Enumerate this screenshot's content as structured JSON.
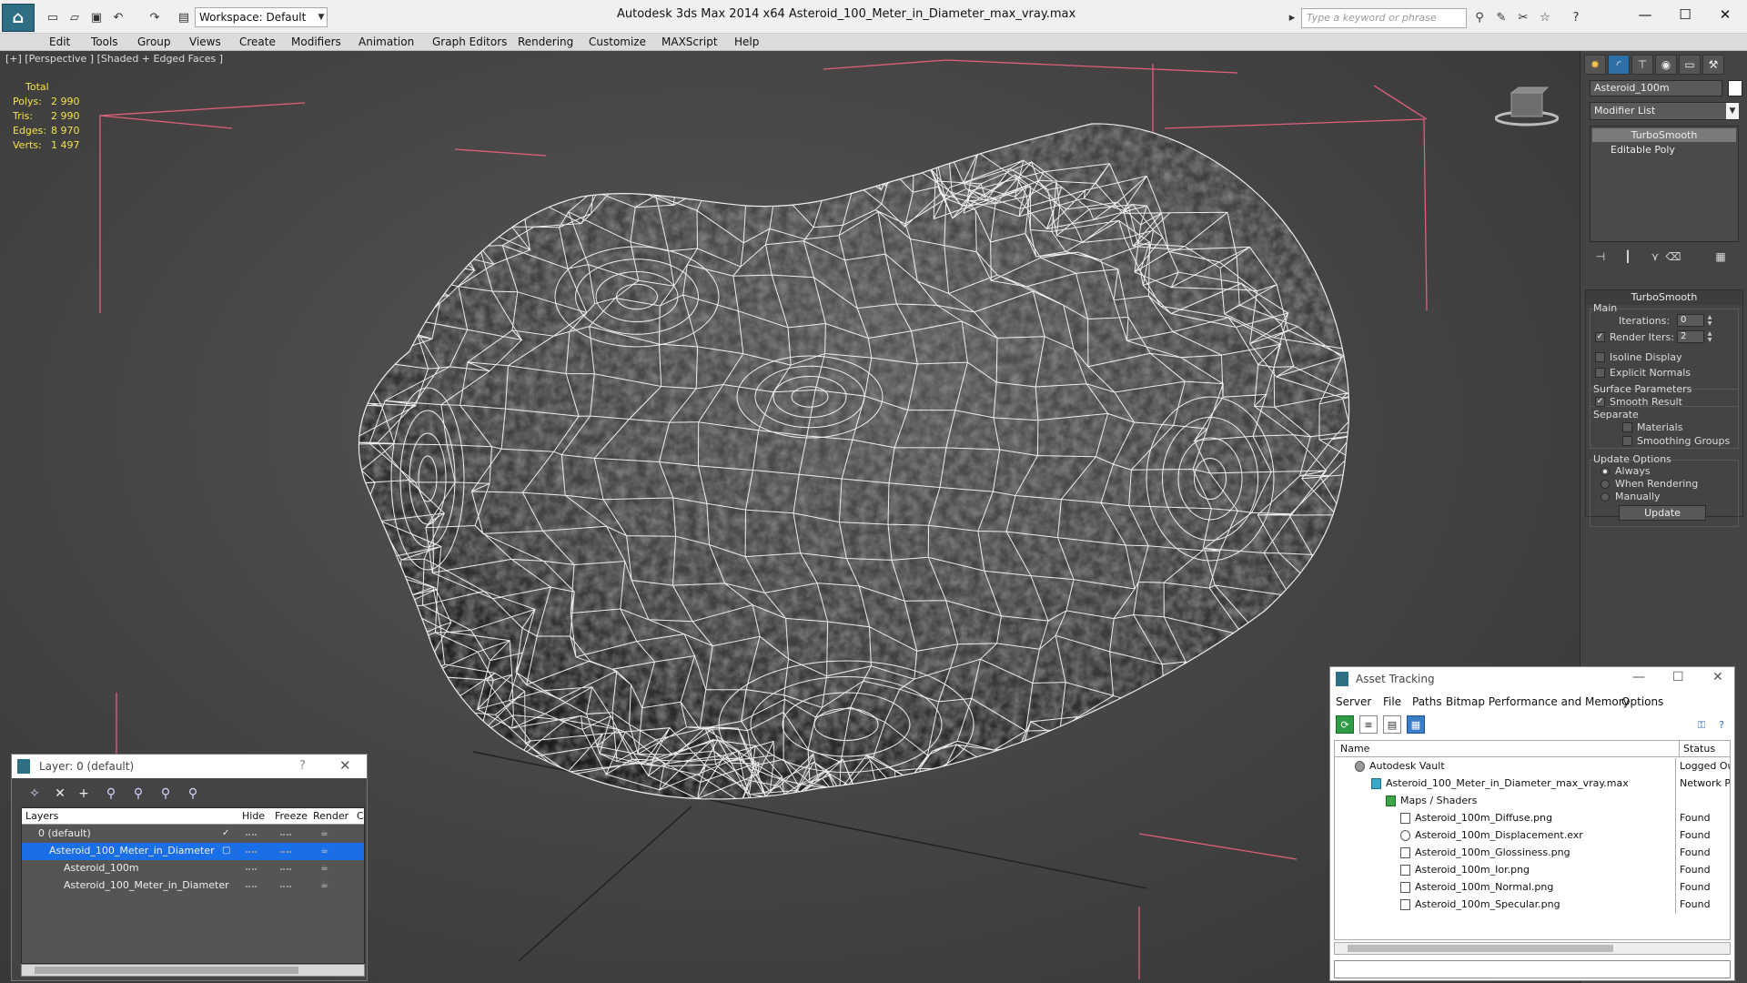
{
  "titlebar": {
    "window_title": "Autodesk 3ds Max  2014 x64      Asteroid_100_Meter_in_Diameter_max_vray.max",
    "workspace": "Workspace: Default",
    "search_placeholder": "Type a keyword or phrase",
    "minimize": "—",
    "maximize": "☐",
    "close": "✕"
  },
  "menu": [
    "Edit",
    "Tools",
    "Group",
    "Views",
    "Create",
    "Modifiers",
    "Animation",
    "Graph Editors",
    "Rendering",
    "Customize",
    "MAXScript",
    "Help"
  ],
  "viewport": {
    "label": "[+] [Perspective ] [Shaded + Edged Faces ]",
    "stats": {
      "total_label": "Total",
      "rows": [
        {
          "k": "Polys:",
          "v": "2 990"
        },
        {
          "k": "Tris:",
          "v": "2 990"
        },
        {
          "k": "Edges:",
          "v": "8 970"
        },
        {
          "k": "Verts:",
          "v": "1 497"
        }
      ]
    },
    "wire_color": "#ffffff",
    "bbox_color": "#e0607a"
  },
  "command_panel": {
    "object_name": "Asteroid_100m",
    "modifier_list": "Modifier List",
    "stack": [
      "TurboSmooth",
      "Editable Poly"
    ],
    "rollout_title": "TurboSmooth",
    "main_label": "Main",
    "iterations_label": "Iterations:",
    "iterations_value": "0",
    "render_iters_label": "Render Iters:",
    "render_iters_value": "2",
    "isoline_label": "Isoline Display",
    "explicit_normals_label": "Explicit Normals",
    "surface_params_label": "Surface Parameters",
    "smooth_result_label": "Smooth Result",
    "separate_label": "Separate",
    "materials_label": "Materials",
    "smoothing_groups_label": "Smoothing Groups",
    "update_options_label": "Update Options",
    "always_label": "Always",
    "when_rendering_label": "When Rendering",
    "manually_label": "Manually",
    "update_button": "Update"
  },
  "layer_dialog": {
    "title": "Layer: 0 (default)",
    "help": "?",
    "close": "✕",
    "columns": [
      "Layers",
      "Hide",
      "Freeze",
      "Render",
      "C"
    ],
    "rows": [
      {
        "name": "0 (default)"
      },
      {
        "name": "Asteroid_100_Meter_in_Diameter"
      },
      {
        "name": "Asteroid_100m"
      },
      {
        "name": "Asteroid_100_Meter_in_Diameter"
      }
    ]
  },
  "asset_dialog": {
    "title": "Asset Tracking",
    "minimize": "—",
    "maximize": "☐",
    "close": "✕",
    "menu": [
      "Server",
      "File",
      "Paths",
      "Bitmap Performance and Memory",
      "Options"
    ],
    "columns": [
      "Name",
      "Status"
    ],
    "rows": [
      {
        "name": "Autodesk Vault",
        "status": "Logged Out"
      },
      {
        "name": "Asteroid_100_Meter_in_Diameter_max_vray.max",
        "status": "Network Pa"
      },
      {
        "name": "Maps / Shaders",
        "status": ""
      },
      {
        "name": "Asteroid_100m_Diffuse.png",
        "status": "Found"
      },
      {
        "name": "Asteroid_100m_Displacement.exr",
        "status": "Found"
      },
      {
        "name": "Asteroid_100m_Glossiness.png",
        "status": "Found"
      },
      {
        "name": "Asteroid_100m_Ior.png",
        "status": "Found"
      },
      {
        "name": "Asteroid_100m_Normal.png",
        "status": "Found"
      },
      {
        "name": "Asteroid_100m_Specular.png",
        "status": "Found"
      }
    ]
  },
  "colors": {
    "selection_blue": "#1a6ee6",
    "stats_yellow": "#f5e24a"
  }
}
